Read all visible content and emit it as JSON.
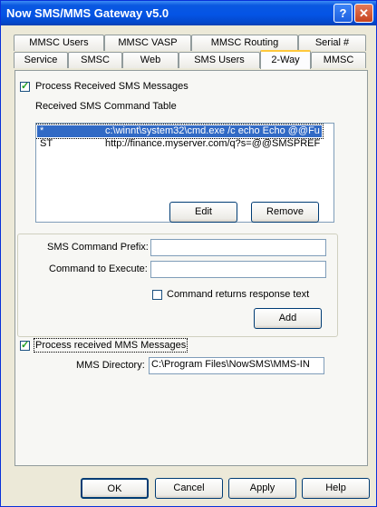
{
  "window": {
    "title": "Now SMS/MMS Gateway v5.0"
  },
  "tabs_top": [
    "MMSC Users",
    "MMSC VASP",
    "MMSC Routing",
    "Serial #"
  ],
  "tabs_bottom": [
    "Service",
    "SMSC",
    "Web",
    "SMS Users",
    "2-Way",
    "MMSC"
  ],
  "active_tab": "2-Way",
  "sms": {
    "process_label": "Process Received SMS Messages",
    "process_checked": true,
    "table_label": "Received SMS Command Table",
    "rows": [
      {
        "prefix": "*",
        "command": "c:\\winnt\\system32\\cmd.exe /c echo Echo @@Fu"
      },
      {
        "prefix": "ST",
        "command": "http://finance.myserver.com/q?s=@@SMSPREF"
      }
    ],
    "edit_label": "Edit",
    "remove_label": "Remove",
    "prefix_label": "SMS Command Prefix:",
    "prefix_value": "",
    "execute_label": "Command to Execute:",
    "execute_value": "",
    "returns_label": "Command returns response text",
    "returns_checked": false,
    "add_label": "Add"
  },
  "mms": {
    "process_label": "Process received MMS Messages",
    "process_checked": true,
    "dir_label": "MMS Directory:",
    "dir_value": "C:\\Program Files\\NowSMS\\MMS-IN"
  },
  "footer": {
    "ok": "OK",
    "cancel": "Cancel",
    "apply": "Apply",
    "help": "Help"
  }
}
